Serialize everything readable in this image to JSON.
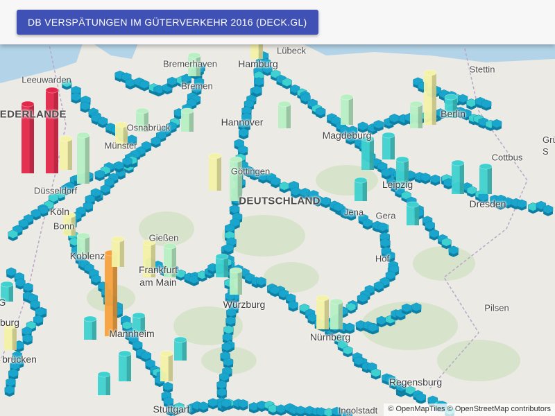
{
  "header": {
    "title": "DB VERSPÄTUNGEN IM GÜTERVERKEHR 2016 (DECK.GL)"
  },
  "map": {
    "attribution": "© OpenMapTiles © OpenStreetMap contributors",
    "country_labels": [
      "NIEDERLANDE",
      "DEUTSCHLAND"
    ],
    "city_labels": [
      "Lübeck",
      "Bremerhaven",
      "Hamburg",
      "Stettin",
      "Leeuwarden",
      "Bremen",
      "Berlin",
      "Hannover",
      "Osnabrück",
      "Magdeburg",
      "Münster",
      "Cottbus",
      "Göttingen",
      "Leipzig",
      "Düsseldorf",
      "Dresden",
      "Köln",
      "Jena",
      "Gera",
      "Bonn",
      "Gießen",
      "Koblenz",
      "Hof",
      "Frankfurt am Main",
      "Würzburg",
      "Pilsen",
      "Mannheim",
      "Nürnberg",
      "Regensburg",
      "Stuttgart",
      "Ingolstadt",
      "brücken",
      "Grü S",
      "G",
      "burg"
    ],
    "colors": {
      "low": "#1aa5cc",
      "low_mid": "#3fd1cf",
      "mid": "#b8f0c4",
      "mid_high": "#f4f2a6",
      "high": "#f7a23e",
      "very_high": "#e3274a",
      "land": "#eceae4",
      "forest": "#cfe0c0",
      "water": "#b3d4e8"
    }
  }
}
